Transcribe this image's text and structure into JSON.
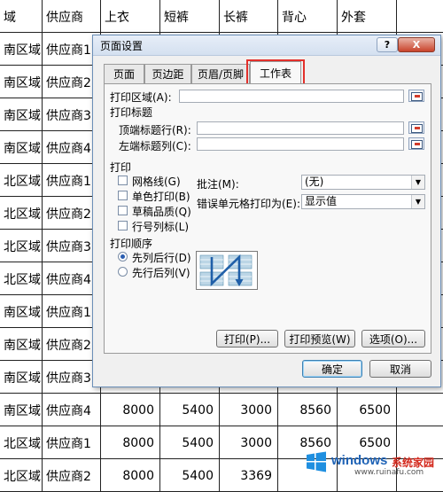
{
  "sheet": {
    "header": [
      "域",
      "供应商",
      "上衣",
      "短裤",
      "长裤",
      "背心",
      "外套"
    ],
    "rows": [
      [
        "南区域",
        "供应商1",
        "",
        "",
        "",
        "",
        ""
      ],
      [
        "南区域",
        "供应商2",
        "",
        "",
        "",
        "",
        ""
      ],
      [
        "南区域",
        "供应商3",
        "",
        "",
        "",
        "",
        ""
      ],
      [
        "南区域",
        "供应商4",
        "",
        "",
        "",
        "",
        ""
      ],
      [
        "北区域",
        "供应商1",
        "",
        "",
        "",
        "",
        ""
      ],
      [
        "北区域",
        "供应商2",
        "",
        "",
        "",
        "",
        ""
      ],
      [
        "北区域",
        "供应商3",
        "",
        "",
        "",
        "",
        ""
      ],
      [
        "北区域",
        "供应商4",
        "",
        "",
        "",
        "",
        ""
      ],
      [
        "南区域",
        "供应商1",
        "",
        "",
        "",
        "",
        ""
      ],
      [
        "南区域",
        "供应商2",
        "",
        "",
        "",
        "",
        ""
      ],
      [
        "南区域",
        "供应商3",
        "",
        "",
        "",
        "",
        ""
      ],
      [
        "南区域",
        "供应商4",
        "8000",
        "5400",
        "3000",
        "8560",
        "6500"
      ],
      [
        "北区域",
        "供应商1",
        "8000",
        "5400",
        "3000",
        "8560",
        "6500"
      ],
      [
        "北区域",
        "供应商2",
        "8000",
        "5400",
        "3369",
        "",
        ""
      ]
    ]
  },
  "dialog": {
    "title": "页面设置",
    "help_label": "?",
    "close_label": "X",
    "tabs": [
      "页面",
      "页边距",
      "页眉/页脚",
      "工作表"
    ],
    "active_tab": "工作表",
    "print_area_label": "打印区域(A):",
    "print_titles_group": "打印标题",
    "rows_to_repeat_label": "顶端标题行(R):",
    "cols_to_repeat_label": "左端标题列(C):",
    "print_group": "打印",
    "gridlines_label": "网格线(G)",
    "black_white_label": "单色打印(B)",
    "draft_label": "草稿品质(Q)",
    "row_col_headings_label": "行号列标(L)",
    "comments_label": "批注(M):",
    "comments_value": "(无)",
    "cell_errors_label": "错误单元格打印为(E):",
    "cell_errors_value": "显示值",
    "page_order_group": "打印顺序",
    "down_then_over_label": "先列后行(D)",
    "over_then_down_label": "先行后列(V)",
    "print_button": "打印(P)...",
    "print_preview_button": "打印预览(W)",
    "options_button": "选项(O)...",
    "ok_button": "确定",
    "cancel_button": "取消"
  },
  "watermark": {
    "brand": "windows",
    "suffix": "系统家园",
    "url": "www.ruinafu.com"
  },
  "colors": {
    "highlight": "#e3302b",
    "watermark_blue": "#1f63b6",
    "watermark_red": "#d42a1e"
  }
}
